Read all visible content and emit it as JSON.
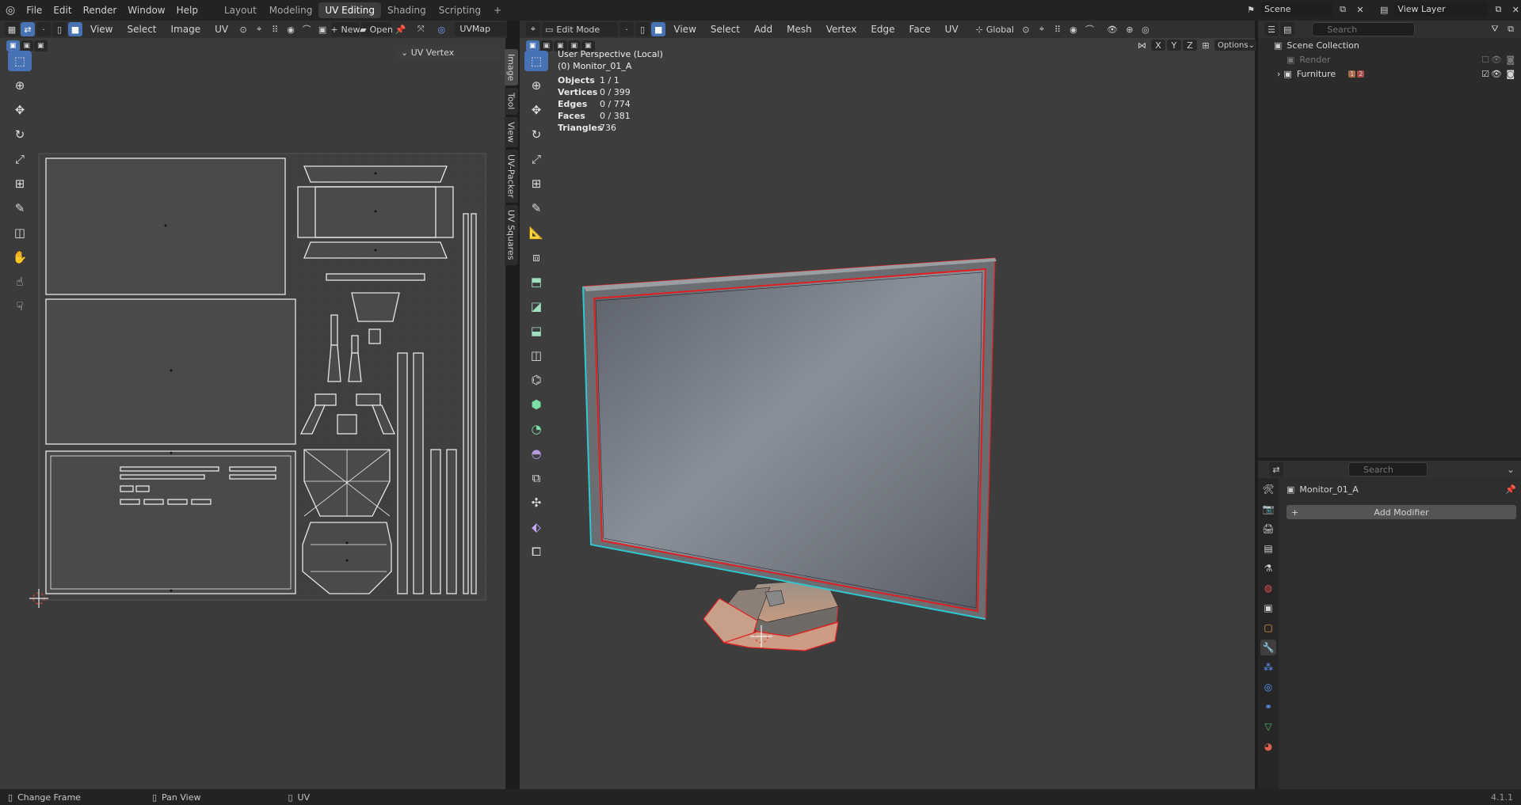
{
  "app": {
    "version": "4.1.1"
  },
  "topbar": {
    "menus": [
      "File",
      "Edit",
      "Render",
      "Window",
      "Help"
    ],
    "workspaces": [
      {
        "label": "Layout",
        "active": false
      },
      {
        "label": "Modeling",
        "active": false
      },
      {
        "label": "UV Editing",
        "active": true
      },
      {
        "label": "Shading",
        "active": false
      },
      {
        "label": "Scripting",
        "active": false
      }
    ],
    "scene_label": "Scene",
    "view_layer_label": "View Layer"
  },
  "uv_editor": {
    "menus": [
      "View",
      "Select",
      "Image",
      "UV"
    ],
    "new_label": "New",
    "open_label": "Open",
    "uvmap_value": "UVMap",
    "sidebar_panel_title": "UV Vertex",
    "side_tabs": [
      "Image",
      "Tool",
      "View",
      "UV-Packer",
      "UV Squares"
    ]
  },
  "viewport": {
    "mode_label": "Edit Mode",
    "menus": [
      "View",
      "Select",
      "Add",
      "Mesh",
      "Vertex",
      "Edge",
      "Face",
      "UV"
    ],
    "transform_orientation": "Global",
    "axis_labels": [
      "X",
      "Y",
      "Z"
    ],
    "options_label": "Options",
    "overlay_title": "User Perspective (Local)",
    "overlay_object": "(0) Monitor_01_A",
    "stats": [
      {
        "key": "Objects",
        "value": "1 / 1"
      },
      {
        "key": "Vertices",
        "value": "0 / 399"
      },
      {
        "key": "Edges",
        "value": "0 / 774"
      },
      {
        "key": "Faces",
        "value": "0 / 381"
      },
      {
        "key": "Triangles",
        "value": "736"
      }
    ]
  },
  "outliner": {
    "search_placeholder": "Search",
    "items": [
      {
        "label": "Scene Collection",
        "indent": 0
      },
      {
        "label": "Render",
        "indent": 1
      },
      {
        "label": "Furniture",
        "indent": 1
      }
    ],
    "furniture_badge1": "1",
    "furniture_badge2": "2"
  },
  "properties": {
    "search_placeholder": "Search",
    "object_name": "Monitor_01_A",
    "add_modifier_label": "Add Modifier"
  },
  "statusbar": {
    "items": [
      "Change Frame",
      "Pan View",
      "UV"
    ]
  },
  "colors": {
    "accent": "#4772b3",
    "selection_red": "#e02020",
    "seam_cyan": "#2ec8d0"
  }
}
